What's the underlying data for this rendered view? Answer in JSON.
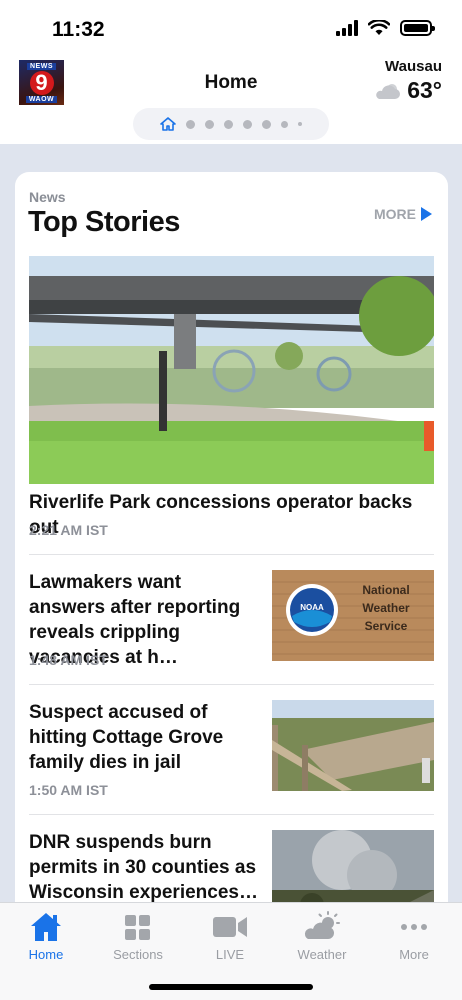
{
  "status_bar": {
    "time": "11:32"
  },
  "header": {
    "logo": {
      "top_text": "NEWS",
      "number": "9",
      "bottom_text": "WAOW"
    },
    "title": "Home",
    "weather": {
      "city": "Wausau",
      "temperature": "63°",
      "icon": "partly-cloudy-icon"
    },
    "pager": {
      "pages": 8,
      "current": 1,
      "first_icon": "home-icon"
    }
  },
  "top_stories": {
    "kicker": "News",
    "title": "Top Stories",
    "more_label": "MORE",
    "hero": {
      "headline": "Riverlife Park concessions operator backs out",
      "time": "2:21 AM IST"
    },
    "stories": [
      {
        "headline": "Lawmakers want answers after reporting reveals crippling vacancies at h…",
        "time": "1:48 AM IST",
        "thumb_text": [
          "National",
          "Weather",
          "Service"
        ],
        "thumb_logo": "NOAA"
      },
      {
        "headline": "Suspect accused of hitting Cottage Grove family dies in jail",
        "time": "1:50 AM IST"
      },
      {
        "headline": "DNR suspends burn permits in 30 counties as Wisconsin experiences…",
        "time": ""
      }
    ]
  },
  "tab_bar": {
    "tabs": [
      {
        "label": "Home",
        "icon": "home-icon",
        "active": true
      },
      {
        "label": "Sections",
        "icon": "grid-icon",
        "active": false
      },
      {
        "label": "LIVE",
        "icon": "video-camera-icon",
        "active": false
      },
      {
        "label": "Weather",
        "icon": "partly-cloudy-icon",
        "active": false
      },
      {
        "label": "More",
        "icon": "ellipsis-icon",
        "active": false
      }
    ]
  },
  "colors": {
    "accent": "#1a73e8",
    "background": "#dfe4ee",
    "meta_text": "#8d9098"
  }
}
